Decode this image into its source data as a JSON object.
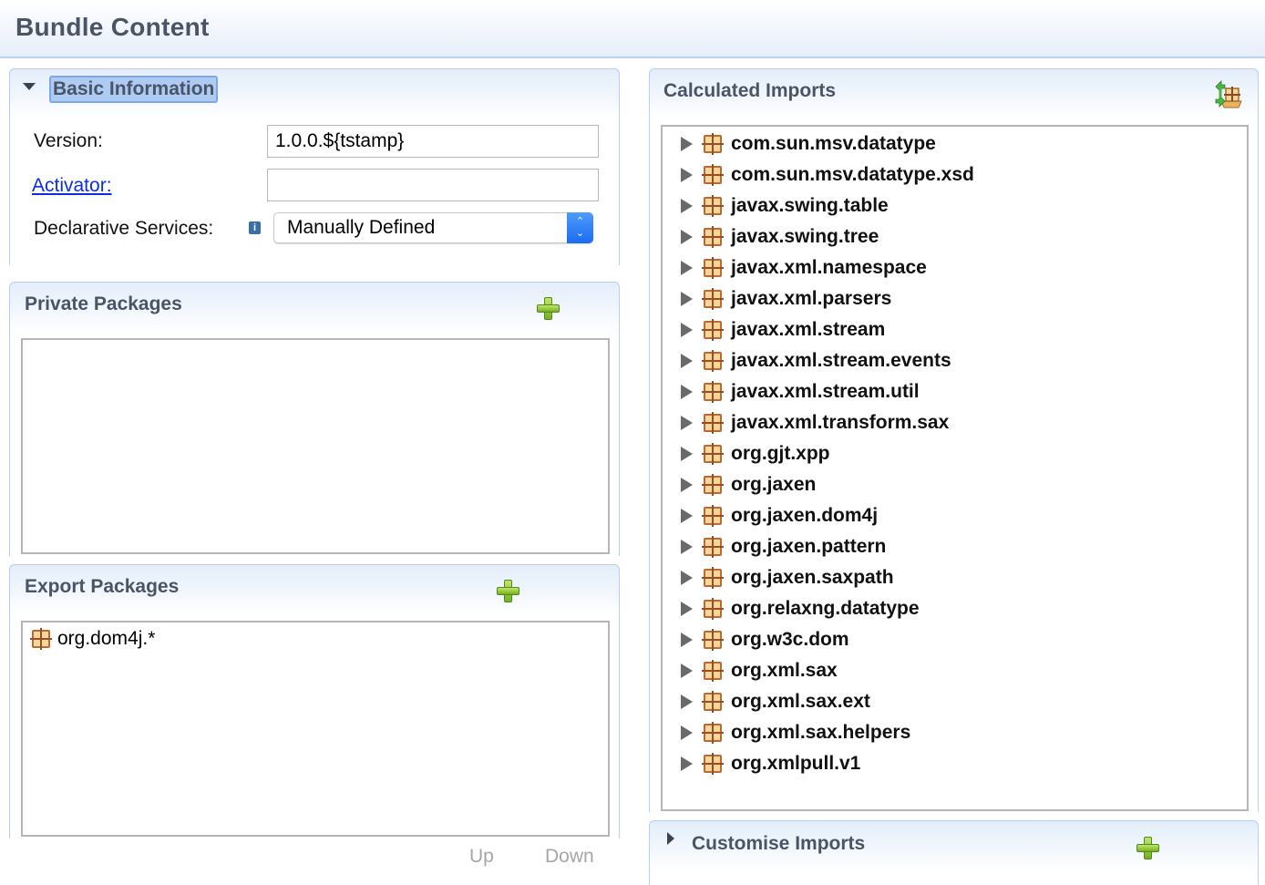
{
  "page": {
    "title": "Bundle Content"
  },
  "basic_information": {
    "title": "Basic Information",
    "version_label": "Version:",
    "version_value": "1.0.0.${tstamp}",
    "activator_label": "Activator:",
    "activator_value": "",
    "declarative_services_label": "Declarative Services:",
    "declarative_services_value": "Manually Defined",
    "info_icon_glyph": "i"
  },
  "private_packages": {
    "title": "Private Packages",
    "items": []
  },
  "export_packages": {
    "title": "Export Packages",
    "items": [
      {
        "label": "org.dom4j.*",
        "icon": "package-icon"
      }
    ],
    "up_label": "Up",
    "down_label": "Down"
  },
  "calculated_imports": {
    "title": "Calculated Imports",
    "items": [
      "com.sun.msv.datatype",
      "com.sun.msv.datatype.xsd",
      "javax.swing.table",
      "javax.swing.tree",
      "javax.xml.namespace",
      "javax.xml.parsers",
      "javax.xml.stream",
      "javax.xml.stream.events",
      "javax.xml.stream.util",
      "javax.xml.transform.sax",
      "org.gjt.xpp",
      "org.jaxen",
      "org.jaxen.dom4j",
      "org.jaxen.pattern",
      "org.jaxen.saxpath",
      "org.relaxng.datatype",
      "org.w3c.dom",
      "org.xml.sax",
      "org.xml.sax.ext",
      "org.xml.sax.helpers",
      "org.xmlpull.v1"
    ]
  },
  "customise_imports": {
    "title": "Customise Imports"
  },
  "colors": {
    "header_text": "#4a5467",
    "link": "#0b2fe0",
    "section_border": "#b8cff0",
    "add_green": "#72b21f",
    "select_blue": "#1a6cf0"
  }
}
